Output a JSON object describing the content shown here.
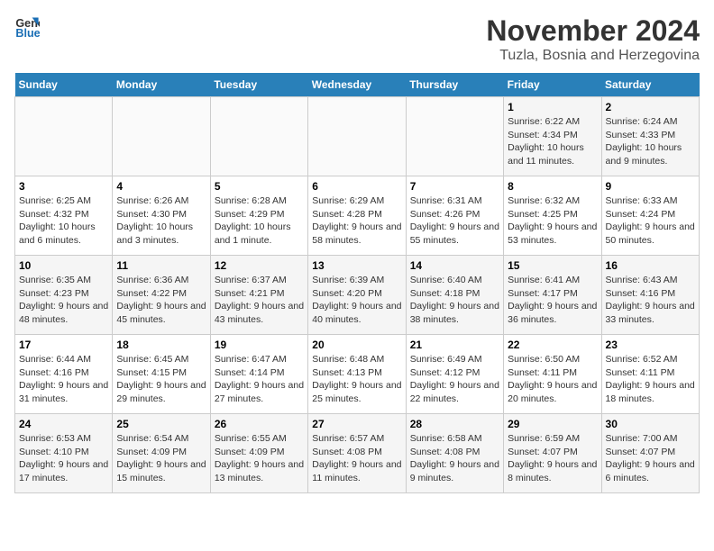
{
  "header": {
    "logo_general": "General",
    "logo_blue": "Blue",
    "title": "November 2024",
    "subtitle": "Tuzla, Bosnia and Herzegovina"
  },
  "columns": [
    "Sunday",
    "Monday",
    "Tuesday",
    "Wednesday",
    "Thursday",
    "Friday",
    "Saturday"
  ],
  "weeks": [
    {
      "days": [
        {
          "num": "",
          "info": ""
        },
        {
          "num": "",
          "info": ""
        },
        {
          "num": "",
          "info": ""
        },
        {
          "num": "",
          "info": ""
        },
        {
          "num": "",
          "info": ""
        },
        {
          "num": "1",
          "info": "Sunrise: 6:22 AM\nSunset: 4:34 PM\nDaylight: 10 hours and 11 minutes."
        },
        {
          "num": "2",
          "info": "Sunrise: 6:24 AM\nSunset: 4:33 PM\nDaylight: 10 hours and 9 minutes."
        }
      ]
    },
    {
      "days": [
        {
          "num": "3",
          "info": "Sunrise: 6:25 AM\nSunset: 4:32 PM\nDaylight: 10 hours and 6 minutes."
        },
        {
          "num": "4",
          "info": "Sunrise: 6:26 AM\nSunset: 4:30 PM\nDaylight: 10 hours and 3 minutes."
        },
        {
          "num": "5",
          "info": "Sunrise: 6:28 AM\nSunset: 4:29 PM\nDaylight: 10 hours and 1 minute."
        },
        {
          "num": "6",
          "info": "Sunrise: 6:29 AM\nSunset: 4:28 PM\nDaylight: 9 hours and 58 minutes."
        },
        {
          "num": "7",
          "info": "Sunrise: 6:31 AM\nSunset: 4:26 PM\nDaylight: 9 hours and 55 minutes."
        },
        {
          "num": "8",
          "info": "Sunrise: 6:32 AM\nSunset: 4:25 PM\nDaylight: 9 hours and 53 minutes."
        },
        {
          "num": "9",
          "info": "Sunrise: 6:33 AM\nSunset: 4:24 PM\nDaylight: 9 hours and 50 minutes."
        }
      ]
    },
    {
      "days": [
        {
          "num": "10",
          "info": "Sunrise: 6:35 AM\nSunset: 4:23 PM\nDaylight: 9 hours and 48 minutes."
        },
        {
          "num": "11",
          "info": "Sunrise: 6:36 AM\nSunset: 4:22 PM\nDaylight: 9 hours and 45 minutes."
        },
        {
          "num": "12",
          "info": "Sunrise: 6:37 AM\nSunset: 4:21 PM\nDaylight: 9 hours and 43 minutes."
        },
        {
          "num": "13",
          "info": "Sunrise: 6:39 AM\nSunset: 4:20 PM\nDaylight: 9 hours and 40 minutes."
        },
        {
          "num": "14",
          "info": "Sunrise: 6:40 AM\nSunset: 4:18 PM\nDaylight: 9 hours and 38 minutes."
        },
        {
          "num": "15",
          "info": "Sunrise: 6:41 AM\nSunset: 4:17 PM\nDaylight: 9 hours and 36 minutes."
        },
        {
          "num": "16",
          "info": "Sunrise: 6:43 AM\nSunset: 4:16 PM\nDaylight: 9 hours and 33 minutes."
        }
      ]
    },
    {
      "days": [
        {
          "num": "17",
          "info": "Sunrise: 6:44 AM\nSunset: 4:16 PM\nDaylight: 9 hours and 31 minutes."
        },
        {
          "num": "18",
          "info": "Sunrise: 6:45 AM\nSunset: 4:15 PM\nDaylight: 9 hours and 29 minutes."
        },
        {
          "num": "19",
          "info": "Sunrise: 6:47 AM\nSunset: 4:14 PM\nDaylight: 9 hours and 27 minutes."
        },
        {
          "num": "20",
          "info": "Sunrise: 6:48 AM\nSunset: 4:13 PM\nDaylight: 9 hours and 25 minutes."
        },
        {
          "num": "21",
          "info": "Sunrise: 6:49 AM\nSunset: 4:12 PM\nDaylight: 9 hours and 22 minutes."
        },
        {
          "num": "22",
          "info": "Sunrise: 6:50 AM\nSunset: 4:11 PM\nDaylight: 9 hours and 20 minutes."
        },
        {
          "num": "23",
          "info": "Sunrise: 6:52 AM\nSunset: 4:11 PM\nDaylight: 9 hours and 18 minutes."
        }
      ]
    },
    {
      "days": [
        {
          "num": "24",
          "info": "Sunrise: 6:53 AM\nSunset: 4:10 PM\nDaylight: 9 hours and 17 minutes."
        },
        {
          "num": "25",
          "info": "Sunrise: 6:54 AM\nSunset: 4:09 PM\nDaylight: 9 hours and 15 minutes."
        },
        {
          "num": "26",
          "info": "Sunrise: 6:55 AM\nSunset: 4:09 PM\nDaylight: 9 hours and 13 minutes."
        },
        {
          "num": "27",
          "info": "Sunrise: 6:57 AM\nSunset: 4:08 PM\nDaylight: 9 hours and 11 minutes."
        },
        {
          "num": "28",
          "info": "Sunrise: 6:58 AM\nSunset: 4:08 PM\nDaylight: 9 hours and 9 minutes."
        },
        {
          "num": "29",
          "info": "Sunrise: 6:59 AM\nSunset: 4:07 PM\nDaylight: 9 hours and 8 minutes."
        },
        {
          "num": "30",
          "info": "Sunrise: 7:00 AM\nSunset: 4:07 PM\nDaylight: 9 hours and 6 minutes."
        }
      ]
    }
  ]
}
